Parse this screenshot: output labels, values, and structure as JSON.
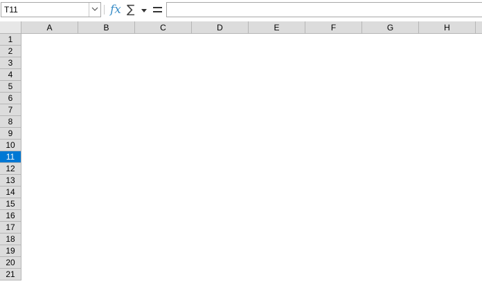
{
  "formula_bar": {
    "name_box_value": "T11",
    "function_wizard_label": "𝑓𝑥",
    "sum_label": "∑",
    "formula_value": ""
  },
  "columns": [
    "A",
    "B",
    "C",
    "D",
    "E",
    "F",
    "G",
    "H"
  ],
  "rows": [
    "1",
    "2",
    "3",
    "4",
    "5",
    "6",
    "7",
    "8",
    "9",
    "10",
    "11",
    "12",
    "13",
    "14",
    "15",
    "16",
    "17",
    "18",
    "19",
    "20",
    "21"
  ],
  "active_row": "11",
  "colors": {
    "header_bg": "#dcdcdc",
    "active_row_bg": "#0078d4",
    "fx_color": "#3c8fc8"
  }
}
